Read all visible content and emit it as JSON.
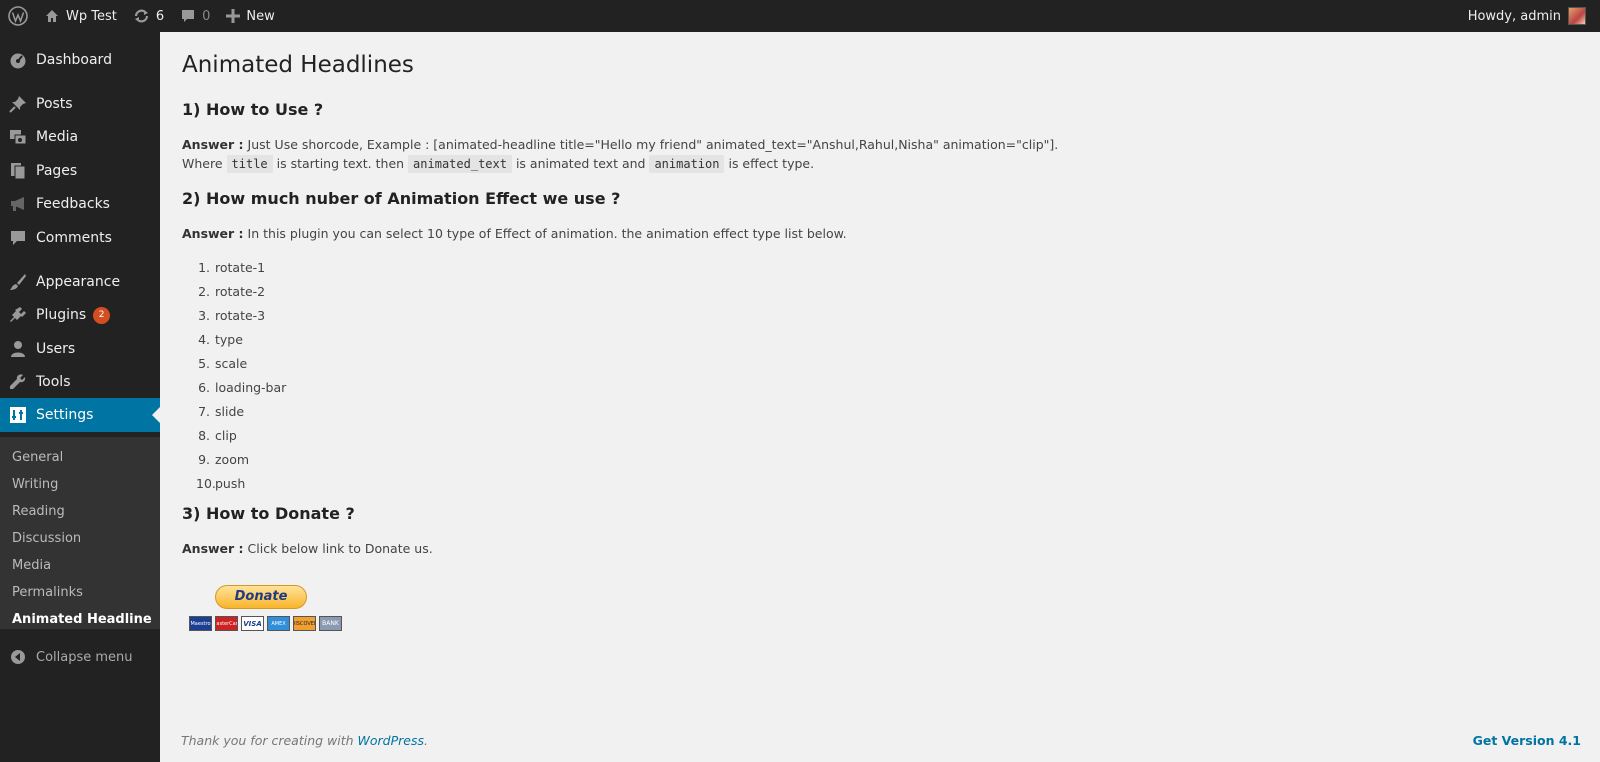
{
  "adminbar": {
    "site_name": "Wp Test",
    "updates_count": "6",
    "comments_count": "0",
    "new_label": "New",
    "howdy": "Howdy, admin"
  },
  "sidebar": {
    "items": [
      {
        "label": "Dashboard",
        "icon": "dashboard-icon"
      },
      {
        "label": "Posts",
        "icon": "pin-icon"
      },
      {
        "label": "Media",
        "icon": "media-icon"
      },
      {
        "label": "Pages",
        "icon": "pages-icon"
      },
      {
        "label": "Feedbacks",
        "icon": "megaphone-icon"
      },
      {
        "label": "Comments",
        "icon": "comment-icon"
      },
      {
        "label": "Appearance",
        "icon": "brush-icon"
      },
      {
        "label": "Plugins",
        "icon": "plug-icon",
        "badge": "2"
      },
      {
        "label": "Users",
        "icon": "user-icon"
      },
      {
        "label": "Tools",
        "icon": "wrench-icon"
      },
      {
        "label": "Settings",
        "icon": "settings-icon"
      }
    ],
    "submenu": [
      "General",
      "Writing",
      "Reading",
      "Discussion",
      "Media",
      "Permalinks",
      "Animated Headline"
    ],
    "collapse_label": "Collapse menu"
  },
  "content": {
    "title": "Animated Headlines",
    "q1": "1) How to Use ?",
    "answer_label": "Answer :",
    "q1_answer": "Just Use shorcode, Example : [animated-headline title=\"Hello my friend\" animated_text=\"Anshul,Rahul,Nisha\" animation=\"clip\"].",
    "q1_line2_where": "Where",
    "code_title": "title",
    "q1_line2_a": "is starting text. then",
    "code_animated_text": "animated_text",
    "q1_line2_b": "is animated text and",
    "code_animation": "animation",
    "q1_line2_c": "is effect type.",
    "q2": "2) How much nuber of Animation Effect we use ?",
    "q2_answer": "In this plugin you can select 10 type of Effect of animation. the animation effect type list below.",
    "effects": [
      "rotate-1",
      "rotate-2",
      "rotate-3",
      "type",
      "scale",
      "loading-bar",
      "slide",
      "clip",
      "zoom",
      "push"
    ],
    "q3": "3) How to Donate ?",
    "q3_answer": "Click below link to Donate us.",
    "donate_label": "Donate",
    "cards": [
      {
        "label": "Maestro",
        "color": "#1c3f94"
      },
      {
        "label": "MasterCard",
        "color": "#cc2222"
      },
      {
        "label": "VISA",
        "color": "#ffffff"
      },
      {
        "label": "AMEX",
        "color": "#2f8fd8"
      },
      {
        "label": "DISCOVER",
        "color": "#f0a030"
      },
      {
        "label": "BANK",
        "color": "#8a9ab0"
      }
    ]
  },
  "footer": {
    "thanks": "Thank you for creating with",
    "wp_link": "WordPress",
    "period": ".",
    "version": "Get Version 4.1"
  },
  "colors": {
    "accent": "#0074a2",
    "adminbar": "#222222",
    "badge": "#d54e21"
  }
}
